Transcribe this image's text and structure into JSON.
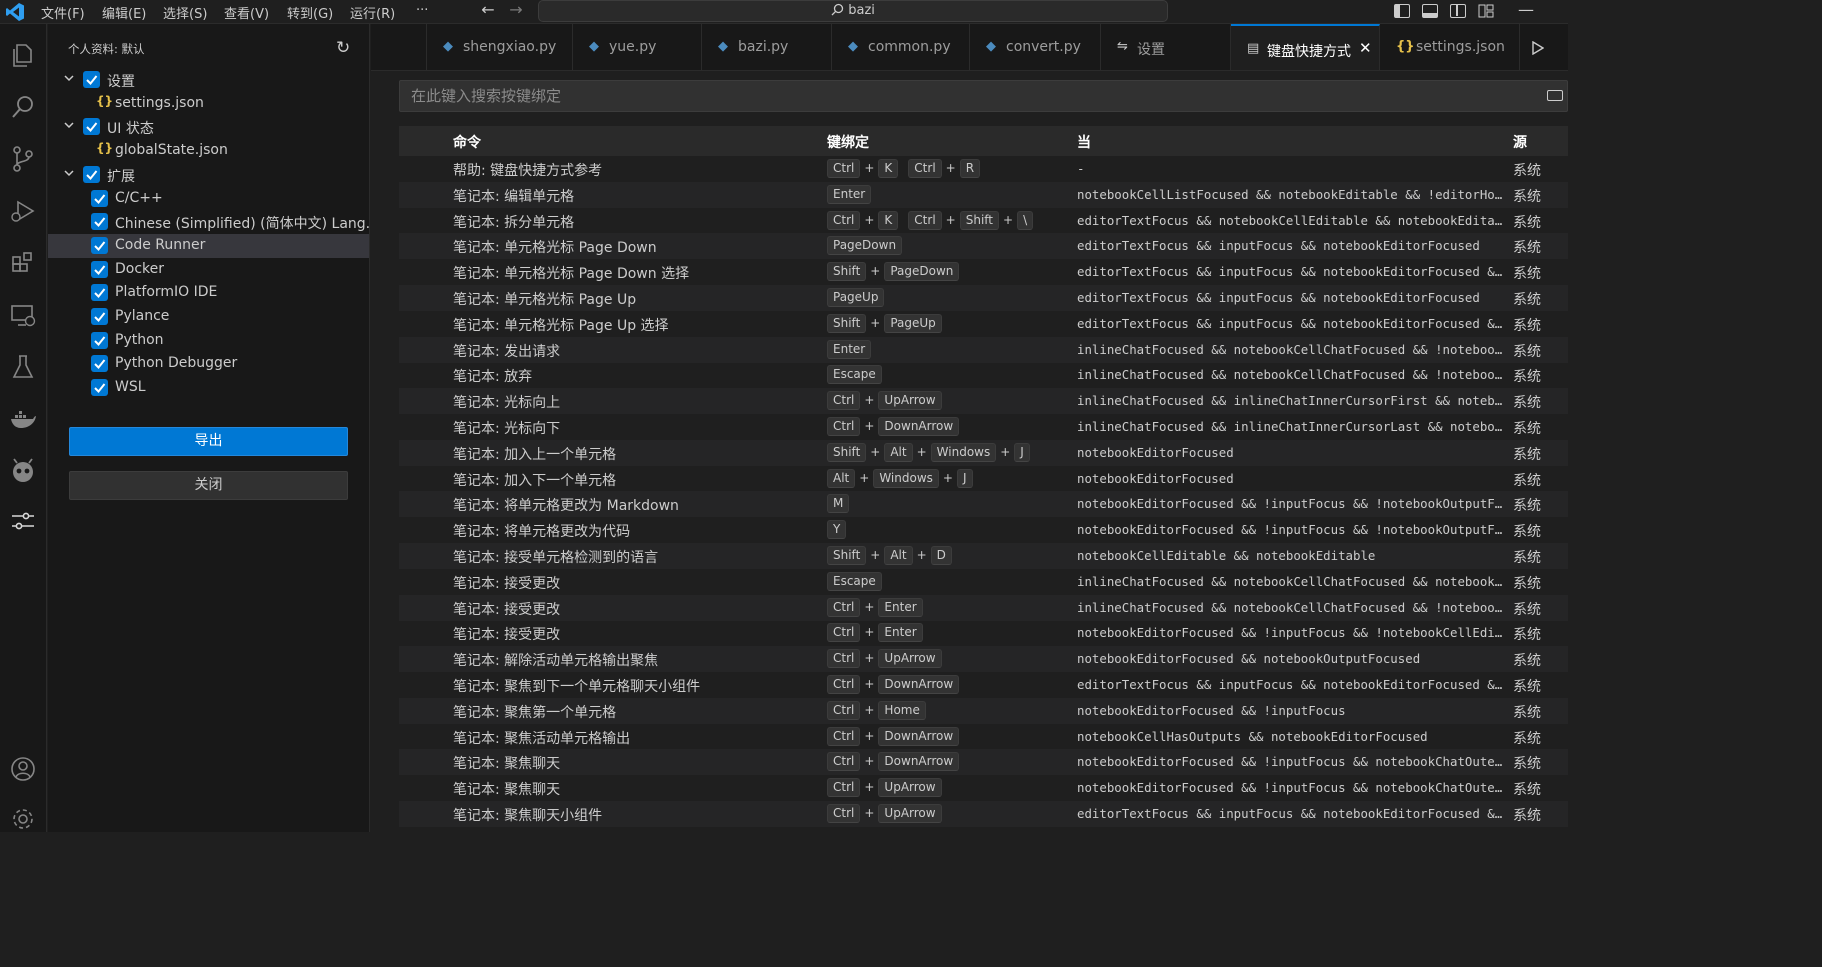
{
  "titlebar": {
    "menus": [
      "文件(F)",
      "编辑(E)",
      "选择(S)",
      "查看(V)",
      "转到(G)",
      "运行(R)",
      "···"
    ],
    "search_text": "bazi"
  },
  "sidebar": {
    "title": "个人资料: 默认",
    "tree": [
      {
        "label": "设置",
        "level": 0,
        "expanded": true,
        "checked": true
      },
      {
        "label": "settings.json",
        "level": 1,
        "type": "json"
      },
      {
        "label": "UI 状态",
        "level": 0,
        "expanded": true,
        "checked": true
      },
      {
        "label": "globalState.json",
        "level": 1,
        "type": "json"
      },
      {
        "label": "扩展",
        "level": 0,
        "expanded": true,
        "checked": true
      },
      {
        "label": "C/C++",
        "level": 1,
        "checked": true
      },
      {
        "label": "Chinese (Simplified) (简体中文) Lang...",
        "level": 1,
        "checked": true
      },
      {
        "label": "Code Runner",
        "level": 1,
        "checked": true,
        "selected": true
      },
      {
        "label": "Docker",
        "level": 1,
        "checked": true
      },
      {
        "label": "PlatformIO IDE",
        "level": 1,
        "checked": true
      },
      {
        "label": "Pylance",
        "level": 1,
        "checked": true
      },
      {
        "label": "Python",
        "level": 1,
        "checked": true
      },
      {
        "label": "Python Debugger",
        "level": 1,
        "checked": true
      },
      {
        "label": "WSL",
        "level": 1,
        "checked": true
      }
    ],
    "export_label": "导出",
    "close_label": "关闭"
  },
  "tabs": [
    {
      "label": "shengxiao.py",
      "icon": "python-icon"
    },
    {
      "label": "yue.py",
      "icon": "python-icon"
    },
    {
      "label": "bazi.py",
      "icon": "python-icon"
    },
    {
      "label": "common.py",
      "icon": "python-icon"
    },
    {
      "label": "convert.py",
      "icon": "python-icon"
    },
    {
      "label": "设置",
      "icon": "settings-icon"
    },
    {
      "label": "键盘快捷方式",
      "icon": "keyboard-icon",
      "active": true
    },
    {
      "label": "settings.json",
      "icon": "json-icon"
    }
  ],
  "keybindings": {
    "search_placeholder": "在此键入搜索按键绑定",
    "headers": {
      "command": "命令",
      "keybinding": "键绑定",
      "when": "当",
      "source": "源"
    },
    "rows": [
      {
        "command": "帮助: 键盘快捷方式参考",
        "keys": [
          [
            "Ctrl",
            "K"
          ],
          [
            "Ctrl",
            "R"
          ]
        ],
        "when": "-",
        "source": "系统"
      },
      {
        "command": "笔记本: 编辑单元格",
        "keys": [
          [
            "Enter"
          ]
        ],
        "when": "notebookCellListFocused && notebookEditable && !editorHoverF...",
        "source": "系统"
      },
      {
        "command": "笔记本: 拆分单元格",
        "keys": [
          [
            "Ctrl",
            "K"
          ],
          [
            "Ctrl",
            "Shift",
            "\\"
          ]
        ],
        "when": "editorTextFocus && notebookCellEditable && notebookEditable ...",
        "source": "系统"
      },
      {
        "command": "笔记本: 单元格光标 Page Down",
        "keys": [
          [
            "PageDown"
          ]
        ],
        "when": "editorTextFocus && inputFocus && notebookEditorFocused",
        "source": "系统"
      },
      {
        "command": "笔记本: 单元格光标 Page Down 选择",
        "keys": [
          [
            "Shift",
            "PageDown"
          ]
        ],
        "when": "editorTextFocus && inputFocus && notebookEditorFocused && !n...",
        "source": "系统"
      },
      {
        "command": "笔记本: 单元格光标 Page Up",
        "keys": [
          [
            "PageUp"
          ]
        ],
        "when": "editorTextFocus && inputFocus && notebookEditorFocused",
        "source": "系统"
      },
      {
        "command": "笔记本: 单元格光标 Page Up 选择",
        "keys": [
          [
            "Shift",
            "PageUp"
          ]
        ],
        "when": "editorTextFocus && inputFocus && notebookEditorFocused && !n...",
        "source": "系统"
      },
      {
        "command": "笔记本: 发出请求",
        "keys": [
          [
            "Enter"
          ]
        ],
        "when": "inlineChatFocused && notebookCellChatFocused && !notebookCel...",
        "source": "系统"
      },
      {
        "command": "笔记本: 放弃",
        "keys": [
          [
            "Escape"
          ]
        ],
        "when": "inlineChatFocused && notebookCellChatFocused && !notebookCel...",
        "source": "系统"
      },
      {
        "command": "笔记本: 光标向上",
        "keys": [
          [
            "Ctrl",
            "UpArrow"
          ]
        ],
        "when": "inlineChatFocused && inlineChatInnerCursorFirst && notebookC...",
        "source": "系统"
      },
      {
        "command": "笔记本: 光标向下",
        "keys": [
          [
            "Ctrl",
            "DownArrow"
          ]
        ],
        "when": "inlineChatFocused && inlineChatInnerCursorLast && notebookCe...",
        "source": "系统"
      },
      {
        "command": "笔记本: 加入上一个单元格",
        "keys": [
          [
            "Shift",
            "Alt",
            "Windows",
            "J"
          ]
        ],
        "when": "notebookEditorFocused",
        "source": "系统"
      },
      {
        "command": "笔记本: 加入下一个单元格",
        "keys": [
          [
            "Alt",
            "Windows",
            "J"
          ]
        ],
        "when": "notebookEditorFocused",
        "source": "系统"
      },
      {
        "command": "笔记本: 将单元格更改为 Markdown",
        "keys": [
          [
            "M"
          ]
        ],
        "when": "notebookEditorFocused && !inputFocus && !notebookOutputFocus...",
        "source": "系统"
      },
      {
        "command": "笔记本: 将单元格更改为代码",
        "keys": [
          [
            "Y"
          ]
        ],
        "when": "notebookEditorFocused && !inputFocus && !notebookOutputFocus...",
        "source": "系统"
      },
      {
        "command": "笔记本: 接受单元格检测到的语言",
        "keys": [
          [
            "Shift",
            "Alt",
            "D"
          ]
        ],
        "when": "notebookCellEditable && notebookEditable",
        "source": "系统"
      },
      {
        "command": "笔记本: 接受更改",
        "keys": [
          [
            "Escape"
          ]
        ],
        "when": "inlineChatFocused && notebookCellChatFocused && notebookChat...",
        "source": "系统"
      },
      {
        "command": "笔记本: 接受更改",
        "keys": [
          [
            "Ctrl",
            "Enter"
          ]
        ],
        "when": "inlineChatFocused && notebookCellChatFocused && !notebookCel...",
        "source": "系统"
      },
      {
        "command": "笔记本: 接受更改",
        "keys": [
          [
            "Ctrl",
            "Enter"
          ]
        ],
        "when": "notebookEditorFocused && !inputFocus && !notebookCellEditorF...",
        "source": "系统"
      },
      {
        "command": "笔记本: 解除活动单元格输出聚焦",
        "keys": [
          [
            "Ctrl",
            "UpArrow"
          ]
        ],
        "when": "notebookEditorFocused && notebookOutputFocused",
        "source": "系统"
      },
      {
        "command": "笔记本: 聚焦到下一个单元格聊天小组件",
        "keys": [
          [
            "Ctrl",
            "DownArrow"
          ]
        ],
        "when": "editorTextFocus && inputFocus && notebookEditorFocused && !a...",
        "source": "系统"
      },
      {
        "command": "笔记本: 聚焦第一个单元格",
        "keys": [
          [
            "Ctrl",
            "Home"
          ]
        ],
        "when": "notebookEditorFocused && !inputFocus",
        "source": "系统"
      },
      {
        "command": "笔记本: 聚焦活动单元格输出",
        "keys": [
          [
            "Ctrl",
            "DownArrow"
          ]
        ],
        "when": "notebookCellHasOutputs && notebookEditorFocused",
        "source": "系统"
      },
      {
        "command": "笔记本: 聚焦聊天",
        "keys": [
          [
            "Ctrl",
            "DownArrow"
          ]
        ],
        "when": "notebookEditorFocused && !inputFocus && notebookChatOuterFoc...",
        "source": "系统"
      },
      {
        "command": "笔记本: 聚焦聊天",
        "keys": [
          [
            "Ctrl",
            "UpArrow"
          ]
        ],
        "when": "notebookEditorFocused && !inputFocus && notebookChatOuterFoc...",
        "source": "系统"
      },
      {
        "command": "笔记本: 聚焦聊天小组件",
        "keys": [
          [
            "Ctrl",
            "UpArrow"
          ]
        ],
        "when": "editorTextFocus && inputFocus && notebookEditorFocused && !a...",
        "source": "系统"
      }
    ]
  },
  "colors": {
    "accent": "#0078d4",
    "background": "#1f1f1f",
    "sidebar": "#181818"
  }
}
